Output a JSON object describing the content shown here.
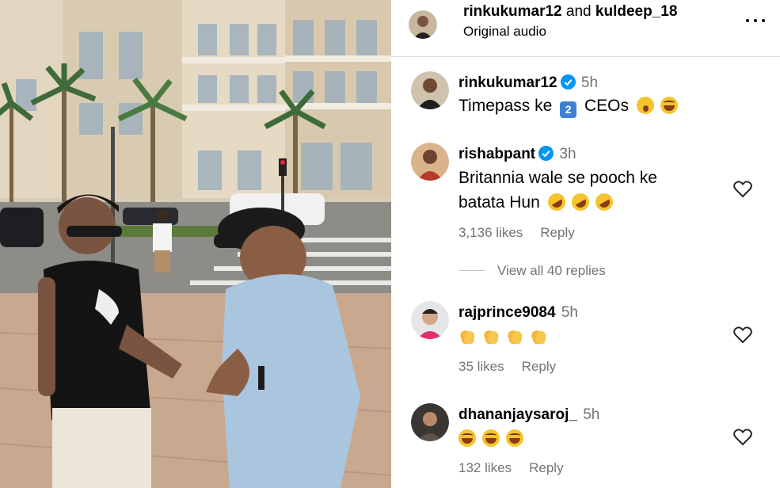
{
  "post": {
    "authors": [
      "rinkukumar12",
      "kuldeep_18"
    ],
    "authors_joiner": "and",
    "audio": "Original audio",
    "more_icon": "more-horizontal-icon"
  },
  "comments": [
    {
      "username": "rinkukumar12",
      "verified": true,
      "time": "5h",
      "text_prefix": "Timepass ke",
      "keycap": "2",
      "text_suffix": "CEOs",
      "emojis": [
        "face-with-open-mouth",
        "laughing-face"
      ]
    },
    {
      "username": "rishabpant",
      "verified": true,
      "time": "3h",
      "text_line1": "Britannia wale se pooch ke",
      "text_line2": "batata Hun",
      "emojis": [
        "rolling-on-floor-laughing",
        "rolling-on-floor-laughing",
        "rolling-on-floor-laughing"
      ],
      "likes": "3,136 likes",
      "reply_label": "Reply",
      "view_replies": "View all 40 replies"
    },
    {
      "username": "rajprince9084",
      "verified": false,
      "time": "5h",
      "emojis": [
        "clapping-hands",
        "clapping-hands",
        "clapping-hands",
        "clapping-hands"
      ],
      "likes": "35 likes",
      "reply_label": "Reply"
    },
    {
      "username": "dhananjaysaroj_",
      "verified": false,
      "time": "5h",
      "emojis": [
        "laughing-face",
        "laughing-face",
        "laughing-face"
      ],
      "likes": "132 likes",
      "reply_label": "Reply"
    }
  ],
  "colors": {
    "verified_badge": "#0095f6",
    "secondary_text": "#737373",
    "divider": "#dbdbdb"
  }
}
